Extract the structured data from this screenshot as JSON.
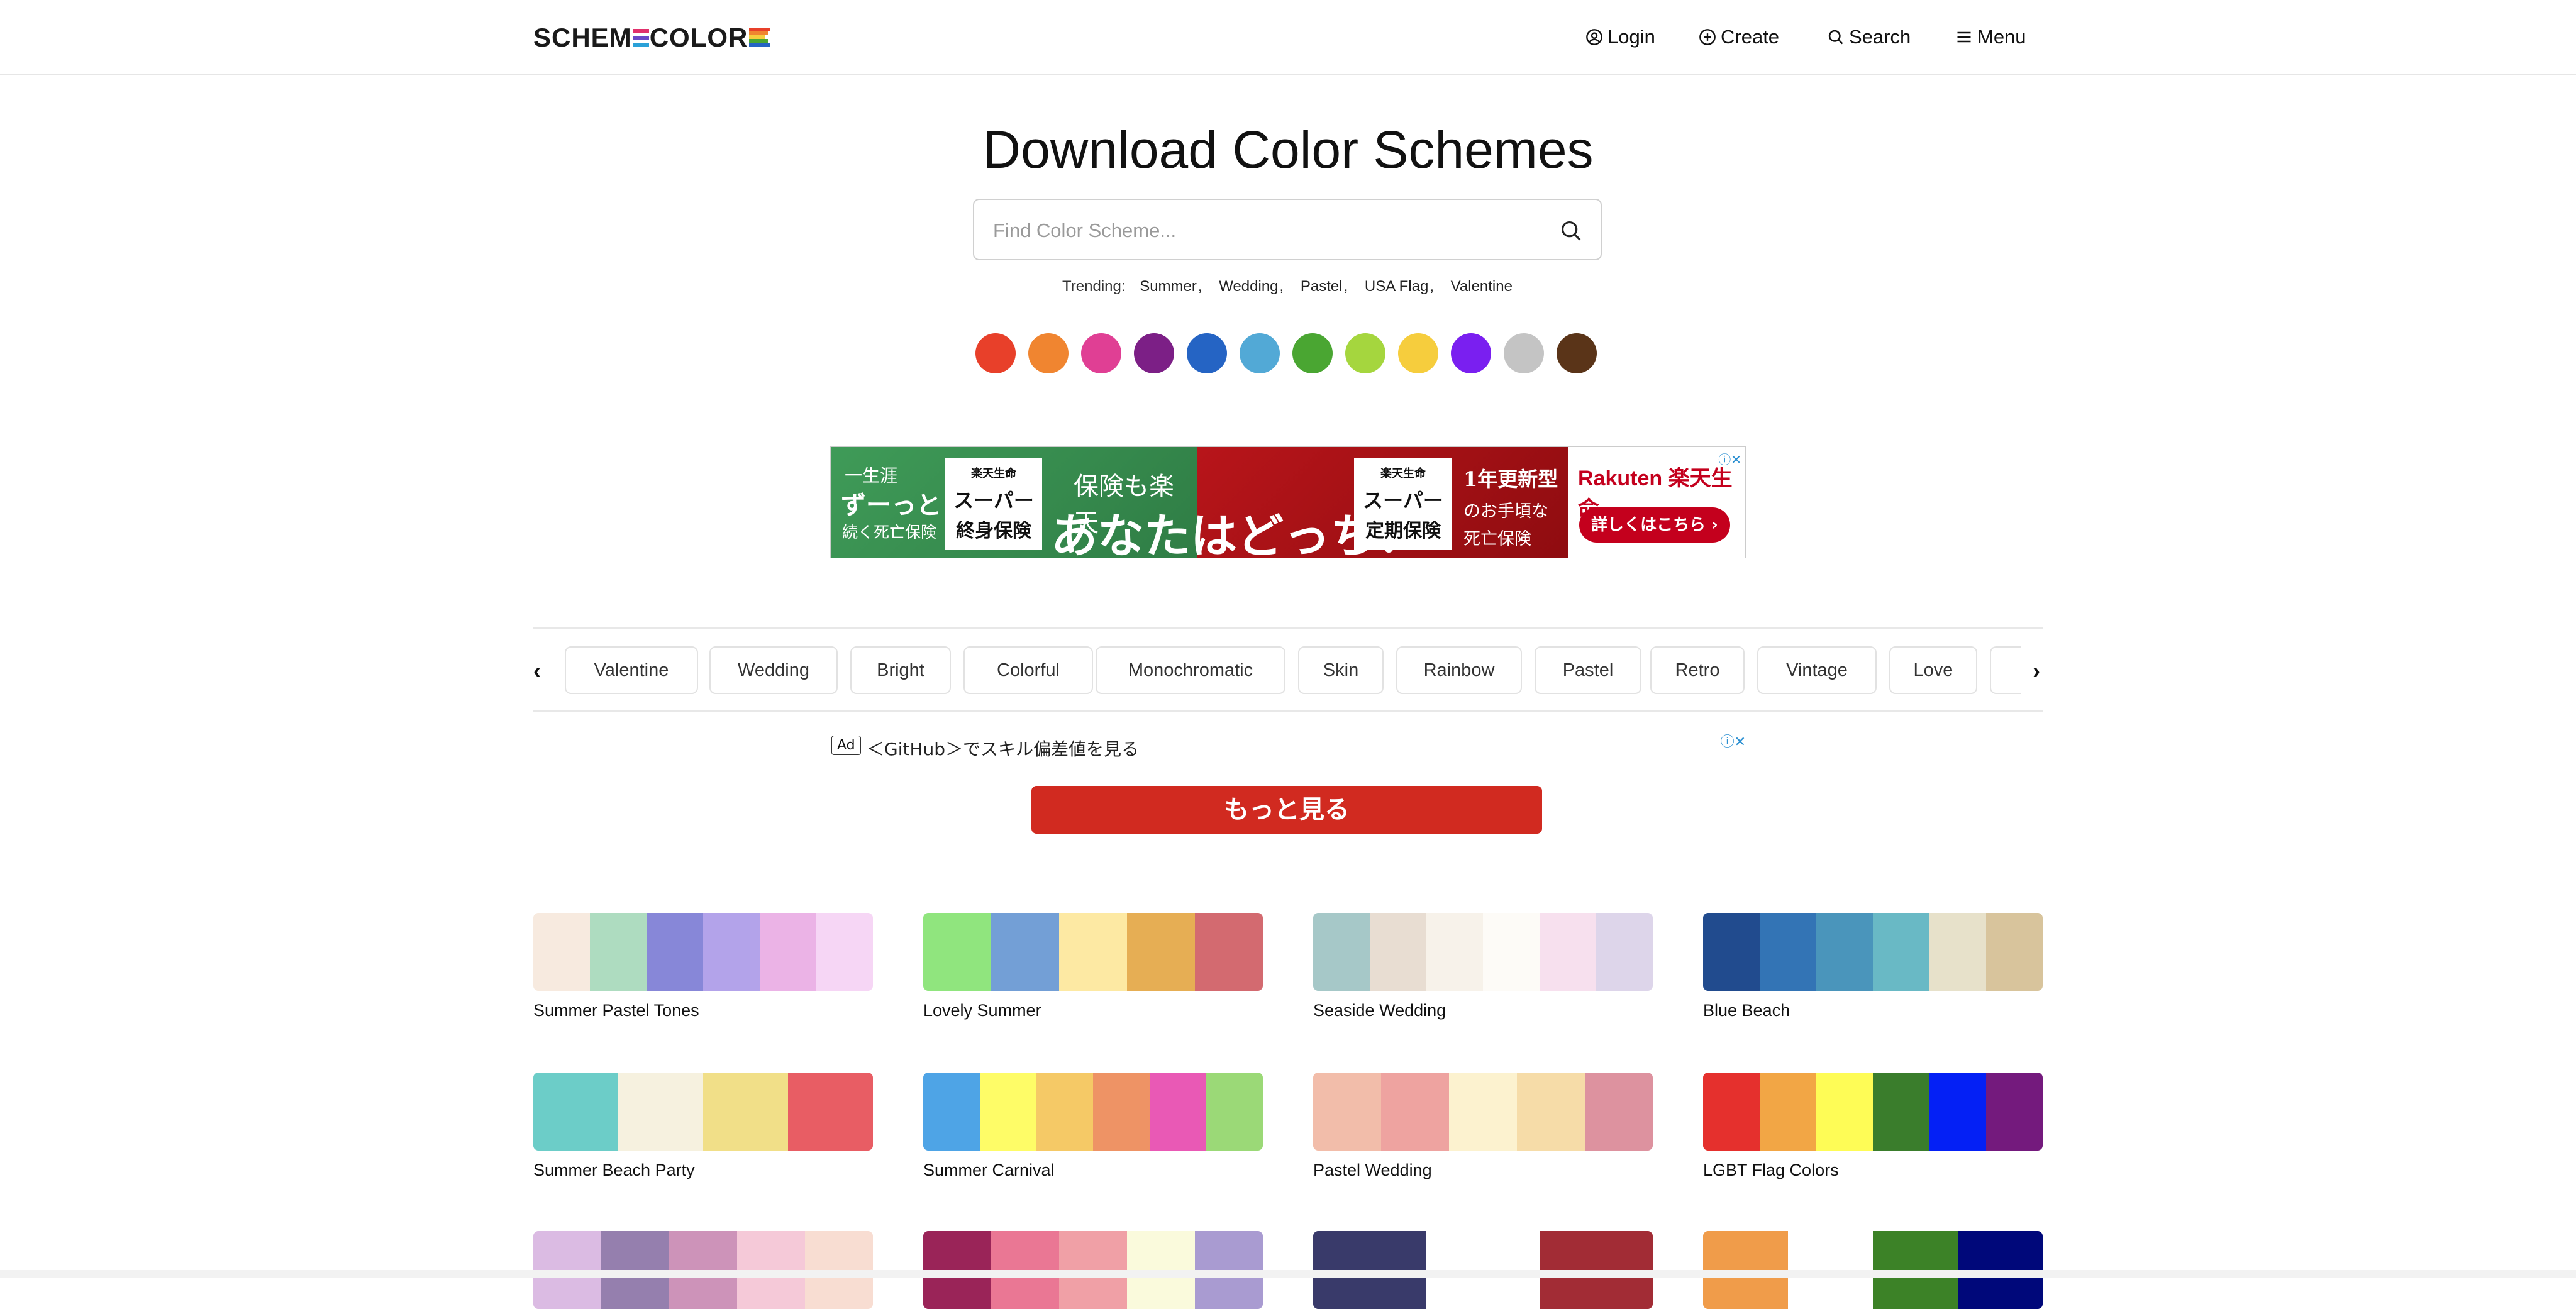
{
  "header": {
    "logo_text_a": "SCHEM",
    "logo_text_b": "COLOR",
    "nav": [
      {
        "label": "Login",
        "icon": "user-circle-icon"
      },
      {
        "label": "Create",
        "icon": "plus-circle-icon"
      },
      {
        "label": "Search",
        "icon": "search-icon"
      },
      {
        "label": "Menu",
        "icon": "hamburger-icon"
      }
    ]
  },
  "hero": {
    "title": "Download Color Schemes",
    "search_placeholder": "Find Color Scheme...",
    "trending_label": "Trending:",
    "trending": [
      "Summer",
      "Wedding",
      "Pastel",
      "USA Flag",
      "Valentine"
    ]
  },
  "color_filters": [
    "#e8402a",
    "#f08530",
    "#e03f94",
    "#7c1f86",
    "#2564c4",
    "#52a9d6",
    "#4aa632",
    "#a5d63e",
    "#f6cd3d",
    "#7a1ff0",
    "#c4c4c4",
    "#5a3418"
  ],
  "ad_banner": {
    "left_small": "一生涯",
    "left_big": "ずーっと",
    "left_sub": "続く死亡保険",
    "box1": [
      "楽天生命",
      "スーパー",
      "終身保険"
    ],
    "mid_top": "保険も楽天",
    "mid_big": "あなたはどっち?",
    "box2": [
      "楽天生命",
      "スーパー",
      "定期保険"
    ],
    "right_top": "1年更新型",
    "right_mid": "のお手頃な",
    "right_sub": "死亡保険",
    "brand": "Rakuten 楽天生命",
    "cta": "詳しくはこちら ›"
  },
  "tags": [
    "Valentine",
    "Wedding",
    "Bright",
    "Colorful",
    "Monochromatic",
    "Skin",
    "Rainbow",
    "Pastel",
    "Retro",
    "Vintage",
    "Love"
  ],
  "ad_text": {
    "badge": "Ad",
    "headline": "＜GitHub＞でスキル偏差値を見る",
    "button": "もっと見る"
  },
  "schemes": [
    {
      "name": "Summer Pastel Tones",
      "colors": [
        "#f7eadf",
        "#aedcc0",
        "#8787d8",
        "#b3a3ea",
        "#ebb3e6",
        "#f6d6f5"
      ]
    },
    {
      "name": "Lovely Summer",
      "colors": [
        "#90e57e",
        "#739fd6",
        "#fde9a3",
        "#e6ae54",
        "#d36a70"
      ]
    },
    {
      "name": "Seaside Wedding",
      "colors": [
        "#a6c8c8",
        "#e8ddd2",
        "#f7f2ea",
        "#fdfbf7",
        "#f7e0ee",
        "#ddd5ea"
      ]
    },
    {
      "name": "Blue Beach",
      "colors": [
        "#214b8e",
        "#3374b5",
        "#4a95bb",
        "#69b9c5",
        "#e7e1ca",
        "#d8c49c"
      ]
    },
    {
      "name": "Summer Beach Party",
      "colors": [
        "#6ccdc8",
        "#f6f1df",
        "#f1df88",
        "#e85d64"
      ]
    },
    {
      "name": "Summer Carnival",
      "colors": [
        "#4ea4e6",
        "#fefc67",
        "#f5c966",
        "#ee9365",
        "#e959b5",
        "#9bd977"
      ]
    },
    {
      "name": "Pastel Wedding",
      "colors": [
        "#f2bdaa",
        "#eea3a0",
        "#fcf2cf",
        "#f6dca8",
        "#dd929f"
      ]
    },
    {
      "name": "LGBT Flag Colors",
      "colors": [
        "#e5302d",
        "#f2a645",
        "#fefc56",
        "#3a7d2c",
        "#0420f5",
        "#741a7d"
      ]
    },
    {
      "name": "",
      "colors": [
        "#dbbbe3",
        "#957fae",
        "#cd93b9",
        "#f5c9d8",
        "#f8ddd2"
      ]
    },
    {
      "name": "",
      "colors": [
        "#9a2458",
        "#ea7794",
        "#f0a0a6",
        "#fafadc",
        "#a99bd1"
      ]
    },
    {
      "name": "",
      "colors": [
        "#393a6a",
        "#ffffff",
        "#a22c35"
      ]
    },
    {
      "name": "",
      "colors": [
        "#f09c4a",
        "#ffffff",
        "#3c8227",
        "#00087a"
      ]
    }
  ]
}
